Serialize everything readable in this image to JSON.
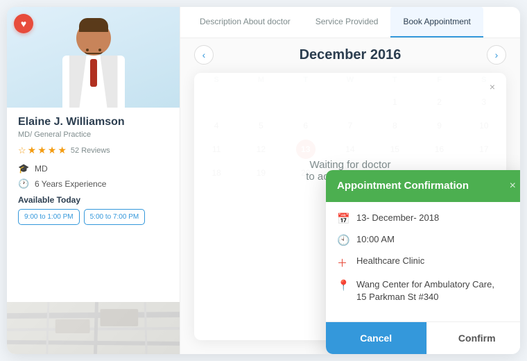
{
  "doctor": {
    "name": "Elaine J. Williamson",
    "specialty": "MD/ General Practice",
    "reviews": "52 Reviews",
    "md_label": "MD",
    "experience": "6 Years Experience",
    "available_label": "Available Today",
    "time_slot_1": "9:00 to 1:00 PM",
    "time_slot_2": "5:00 to 7:00 PM"
  },
  "tabs": {
    "tab1": "Description About doctor",
    "tab2": "Service Provided",
    "tab3": "Book Appointment"
  },
  "calendar": {
    "month_year": "December 2016",
    "days": [
      "S",
      "M",
      "T",
      "W",
      "T",
      "F",
      "S"
    ],
    "today": "13",
    "rows": [
      [
        "",
        "",
        "",
        "",
        "1",
        "2",
        "3"
      ],
      [
        "4",
        "5",
        "6",
        "7",
        "8",
        "9",
        "10"
      ],
      [
        "11",
        "12",
        "13",
        "14",
        "15",
        "16",
        "17"
      ],
      [
        "18",
        "19",
        "20",
        "",
        "",
        "",
        ""
      ]
    ]
  },
  "waiting": {
    "text": "Waiting for doctor\nto accept the boo...",
    "close_label": "×"
  },
  "confirmation": {
    "title": "Appointment Confirmation",
    "close_label": "×",
    "date": "13- December- 2018",
    "time": "10:00 AM",
    "clinic": "Healthcare Clinic",
    "address": "Wang Center for Ambulatory Care,\n15 Parkman St #340",
    "cancel_label": "Cancel",
    "confirm_label": "Confirm"
  },
  "icons": {
    "heart": "♥",
    "prev": "‹",
    "next": "›",
    "close": "×",
    "calendar": "📅",
    "clock": "🕙",
    "plus": "＋",
    "location": "📍",
    "graduation": "🎓",
    "experience": "🕐",
    "hourglass": "⏳"
  }
}
